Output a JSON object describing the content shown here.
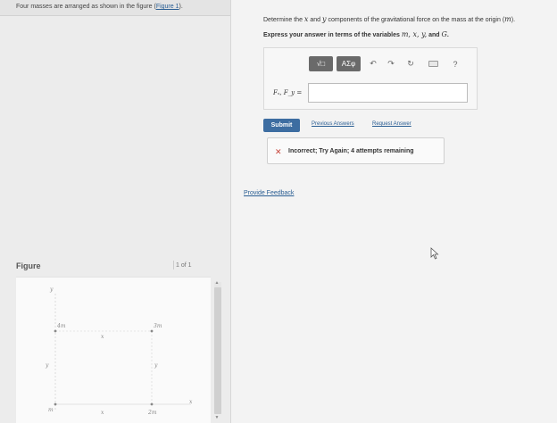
{
  "problem": {
    "text": "Four masses are arranged as shown in the figure (",
    "figure_link": "Figure 1",
    "text_end": ")."
  },
  "instructions": {
    "line1_prefix": "Determine the ",
    "line1_x": "x",
    "line1_mid": " and ",
    "line1_y": "y",
    "line1_suffix": " components of the gravitational force on the mass at the origin (",
    "line1_m": "m",
    "line1_end": ").",
    "line2_prefix": "Express your answer in terms of the variables ",
    "line2_vars": "m, x, y,",
    "line2_and": " and ",
    "line2_G": "G",
    "line2_end": "."
  },
  "toolbar": {
    "sqrt_button": "√□",
    "greek_button": "ΑΣφ",
    "undo": "↶",
    "redo": "↷",
    "reset": "↻",
    "help": "?"
  },
  "answer": {
    "label": "Fₓ, F_y =",
    "value": ""
  },
  "actions": {
    "submit": "Submit",
    "previous_answers": "Previous Answers",
    "request_answer": "Request Answer"
  },
  "feedback": {
    "icon": "x-icon",
    "message": "Incorrect; Try Again; 4 attempts remaining"
  },
  "provide_feedback": "Provide Feedback",
  "figure": {
    "label": "Figure",
    "pager": "1 of 1",
    "labels": {
      "y_axis": "y",
      "x_axis": "x",
      "mass_top_left": "4m",
      "mass_top_right": "3m",
      "mass_origin": "m",
      "mass_bottom_right": "2m",
      "dim_x_top": "x",
      "dim_y_left": "y",
      "dim_y_right": "y",
      "dim_x_bottom": "x"
    }
  },
  "colors": {
    "submit_bg": "#3d6da1",
    "link": "#2a5e93",
    "error": "#c7443a"
  }
}
